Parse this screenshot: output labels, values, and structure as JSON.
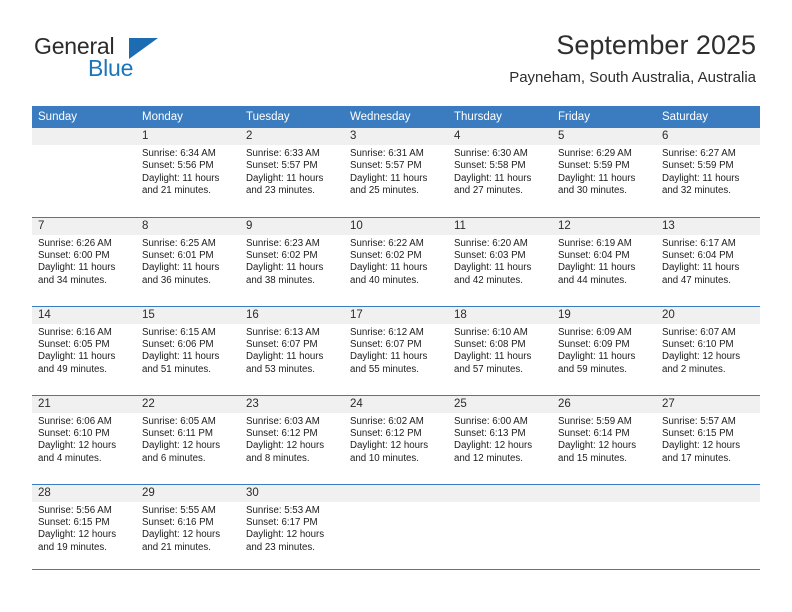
{
  "brand": {
    "name_part1": "General",
    "name_part2": "Blue",
    "triangle_icon": "blue-triangle-icon",
    "accent_color": "#1b6cb0"
  },
  "header": {
    "title": "September 2025",
    "location": "Payneham, South Australia, Australia"
  },
  "theme": {
    "header_blue": "#3a7cbf",
    "daynum_band": "#f0f0f0",
    "text": "#1c1c1c"
  },
  "calendar": {
    "weekday_headers": [
      "Sunday",
      "Monday",
      "Tuesday",
      "Wednesday",
      "Thursday",
      "Friday",
      "Saturday"
    ],
    "weeks": [
      [
        {
          "day": "",
          "empty": true,
          "sunrise": "",
          "sunset": "",
          "daylight1": "",
          "daylight2": ""
        },
        {
          "day": "1",
          "sunrise": "Sunrise: 6:34 AM",
          "sunset": "Sunset: 5:56 PM",
          "daylight1": "Daylight: 11 hours",
          "daylight2": "and 21 minutes."
        },
        {
          "day": "2",
          "sunrise": "Sunrise: 6:33 AM",
          "sunset": "Sunset: 5:57 PM",
          "daylight1": "Daylight: 11 hours",
          "daylight2": "and 23 minutes."
        },
        {
          "day": "3",
          "sunrise": "Sunrise: 6:31 AM",
          "sunset": "Sunset: 5:57 PM",
          "daylight1": "Daylight: 11 hours",
          "daylight2": "and 25 minutes."
        },
        {
          "day": "4",
          "sunrise": "Sunrise: 6:30 AM",
          "sunset": "Sunset: 5:58 PM",
          "daylight1": "Daylight: 11 hours",
          "daylight2": "and 27 minutes."
        },
        {
          "day": "5",
          "sunrise": "Sunrise: 6:29 AM",
          "sunset": "Sunset: 5:59 PM",
          "daylight1": "Daylight: 11 hours",
          "daylight2": "and 30 minutes."
        },
        {
          "day": "6",
          "sunrise": "Sunrise: 6:27 AM",
          "sunset": "Sunset: 5:59 PM",
          "daylight1": "Daylight: 11 hours",
          "daylight2": "and 32 minutes."
        }
      ],
      [
        {
          "day": "7",
          "sunrise": "Sunrise: 6:26 AM",
          "sunset": "Sunset: 6:00 PM",
          "daylight1": "Daylight: 11 hours",
          "daylight2": "and 34 minutes."
        },
        {
          "day": "8",
          "sunrise": "Sunrise: 6:25 AM",
          "sunset": "Sunset: 6:01 PM",
          "daylight1": "Daylight: 11 hours",
          "daylight2": "and 36 minutes."
        },
        {
          "day": "9",
          "sunrise": "Sunrise: 6:23 AM",
          "sunset": "Sunset: 6:02 PM",
          "daylight1": "Daylight: 11 hours",
          "daylight2": "and 38 minutes."
        },
        {
          "day": "10",
          "sunrise": "Sunrise: 6:22 AM",
          "sunset": "Sunset: 6:02 PM",
          "daylight1": "Daylight: 11 hours",
          "daylight2": "and 40 minutes."
        },
        {
          "day": "11",
          "sunrise": "Sunrise: 6:20 AM",
          "sunset": "Sunset: 6:03 PM",
          "daylight1": "Daylight: 11 hours",
          "daylight2": "and 42 minutes."
        },
        {
          "day": "12",
          "sunrise": "Sunrise: 6:19 AM",
          "sunset": "Sunset: 6:04 PM",
          "daylight1": "Daylight: 11 hours",
          "daylight2": "and 44 minutes."
        },
        {
          "day": "13",
          "sunrise": "Sunrise: 6:17 AM",
          "sunset": "Sunset: 6:04 PM",
          "daylight1": "Daylight: 11 hours",
          "daylight2": "and 47 minutes."
        }
      ],
      [
        {
          "day": "14",
          "sunrise": "Sunrise: 6:16 AM",
          "sunset": "Sunset: 6:05 PM",
          "daylight1": "Daylight: 11 hours",
          "daylight2": "and 49 minutes."
        },
        {
          "day": "15",
          "sunrise": "Sunrise: 6:15 AM",
          "sunset": "Sunset: 6:06 PM",
          "daylight1": "Daylight: 11 hours",
          "daylight2": "and 51 minutes."
        },
        {
          "day": "16",
          "sunrise": "Sunrise: 6:13 AM",
          "sunset": "Sunset: 6:07 PM",
          "daylight1": "Daylight: 11 hours",
          "daylight2": "and 53 minutes."
        },
        {
          "day": "17",
          "sunrise": "Sunrise: 6:12 AM",
          "sunset": "Sunset: 6:07 PM",
          "daylight1": "Daylight: 11 hours",
          "daylight2": "and 55 minutes."
        },
        {
          "day": "18",
          "sunrise": "Sunrise: 6:10 AM",
          "sunset": "Sunset: 6:08 PM",
          "daylight1": "Daylight: 11 hours",
          "daylight2": "and 57 minutes."
        },
        {
          "day": "19",
          "sunrise": "Sunrise: 6:09 AM",
          "sunset": "Sunset: 6:09 PM",
          "daylight1": "Daylight: 11 hours",
          "daylight2": "and 59 minutes."
        },
        {
          "day": "20",
          "sunrise": "Sunrise: 6:07 AM",
          "sunset": "Sunset: 6:10 PM",
          "daylight1": "Daylight: 12 hours",
          "daylight2": "and 2 minutes."
        }
      ],
      [
        {
          "day": "21",
          "sunrise": "Sunrise: 6:06 AM",
          "sunset": "Sunset: 6:10 PM",
          "daylight1": "Daylight: 12 hours",
          "daylight2": "and 4 minutes."
        },
        {
          "day": "22",
          "sunrise": "Sunrise: 6:05 AM",
          "sunset": "Sunset: 6:11 PM",
          "daylight1": "Daylight: 12 hours",
          "daylight2": "and 6 minutes."
        },
        {
          "day": "23",
          "sunrise": "Sunrise: 6:03 AM",
          "sunset": "Sunset: 6:12 PM",
          "daylight1": "Daylight: 12 hours",
          "daylight2": "and 8 minutes."
        },
        {
          "day": "24",
          "sunrise": "Sunrise: 6:02 AM",
          "sunset": "Sunset: 6:12 PM",
          "daylight1": "Daylight: 12 hours",
          "daylight2": "and 10 minutes."
        },
        {
          "day": "25",
          "sunrise": "Sunrise: 6:00 AM",
          "sunset": "Sunset: 6:13 PM",
          "daylight1": "Daylight: 12 hours",
          "daylight2": "and 12 minutes."
        },
        {
          "day": "26",
          "sunrise": "Sunrise: 5:59 AM",
          "sunset": "Sunset: 6:14 PM",
          "daylight1": "Daylight: 12 hours",
          "daylight2": "and 15 minutes."
        },
        {
          "day": "27",
          "sunrise": "Sunrise: 5:57 AM",
          "sunset": "Sunset: 6:15 PM",
          "daylight1": "Daylight: 12 hours",
          "daylight2": "and 17 minutes."
        }
      ],
      [
        {
          "day": "28",
          "sunrise": "Sunrise: 5:56 AM",
          "sunset": "Sunset: 6:15 PM",
          "daylight1": "Daylight: 12 hours",
          "daylight2": "and 19 minutes."
        },
        {
          "day": "29",
          "sunrise": "Sunrise: 5:55 AM",
          "sunset": "Sunset: 6:16 PM",
          "daylight1": "Daylight: 12 hours",
          "daylight2": "and 21 minutes."
        },
        {
          "day": "30",
          "sunrise": "Sunrise: 5:53 AM",
          "sunset": "Sunset: 6:17 PM",
          "daylight1": "Daylight: 12 hours",
          "daylight2": "and 23 minutes."
        },
        {
          "day": "",
          "empty": true,
          "sunrise": "",
          "sunset": "",
          "daylight1": "",
          "daylight2": ""
        },
        {
          "day": "",
          "empty": true,
          "sunrise": "",
          "sunset": "",
          "daylight1": "",
          "daylight2": ""
        },
        {
          "day": "",
          "empty": true,
          "sunrise": "",
          "sunset": "",
          "daylight1": "",
          "daylight2": ""
        },
        {
          "day": "",
          "empty": true,
          "sunrise": "",
          "sunset": "",
          "daylight1": "",
          "daylight2": ""
        }
      ]
    ]
  }
}
